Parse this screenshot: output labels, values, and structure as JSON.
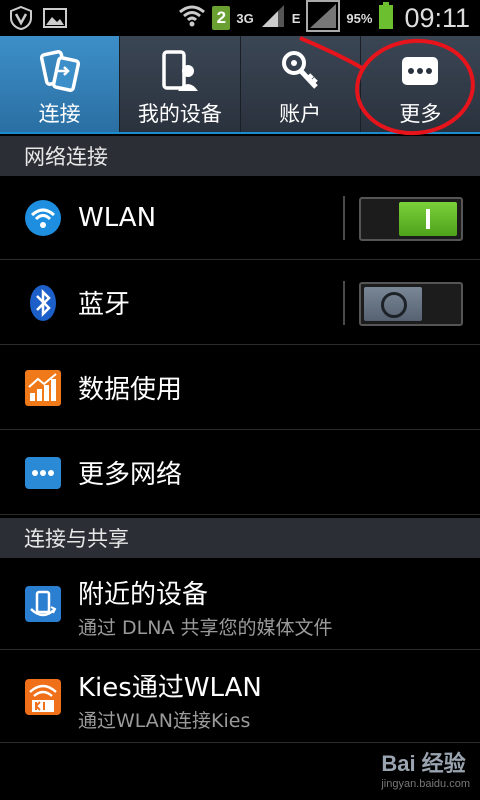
{
  "status_bar": {
    "signal_3g": "3G",
    "signal_e": "E",
    "notification_count": "2",
    "battery": "95%",
    "time": "09:11",
    "icons": [
      "v-shield-icon",
      "image-icon",
      "wifi-icon",
      "signal-icon",
      "battery-icon"
    ]
  },
  "tabs": [
    {
      "label": "连接",
      "icon": "connection-icon",
      "active": true
    },
    {
      "label": "我的设备",
      "icon": "device-icon",
      "active": false
    },
    {
      "label": "账户",
      "icon": "key-icon",
      "active": false
    },
    {
      "label": "更多",
      "icon": "more-icon",
      "active": false
    }
  ],
  "sections": [
    {
      "header": "网络连接",
      "items": [
        {
          "label": "WLAN",
          "icon": "wifi-icon",
          "toggle": "on"
        },
        {
          "label": "蓝牙",
          "icon": "bluetooth-icon",
          "toggle": "off"
        },
        {
          "label": "数据使用",
          "icon": "data-usage-icon"
        },
        {
          "label": "更多网络",
          "icon": "more-networks-icon"
        }
      ]
    },
    {
      "header": "连接与共享",
      "items": [
        {
          "label": "附近的设备",
          "sub": "通过 DLNA 共享您的媒体文件",
          "icon": "nearby-devices-icon"
        },
        {
          "label": "Kies通过WLAN",
          "sub": "通过WLAN连接Kies",
          "icon": "kies-icon"
        }
      ]
    }
  ],
  "watermark": {
    "logo": "Bai 经验",
    "url": "jingyan.baidu.com"
  },
  "colors": {
    "accent": "#1b8dcf",
    "toggle_on": "#5db226",
    "annotation": "#e8141c"
  }
}
